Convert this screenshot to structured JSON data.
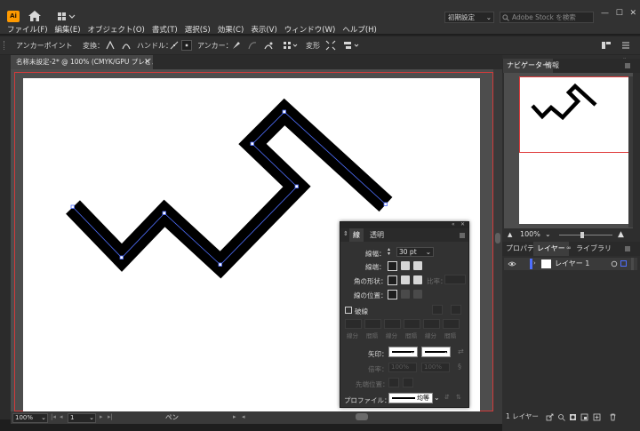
{
  "app": {
    "icon_text": "Ai"
  },
  "menu": [
    "ファイル(F)",
    "編集(E)",
    "オブジェクト(O)",
    "書式(T)",
    "選択(S)",
    "効果(C)",
    "表示(V)",
    "ウィンドウ(W)",
    "ヘルプ(H)"
  ],
  "workspace": {
    "label": "初期設定"
  },
  "search": {
    "placeholder": "Adobe Stock を検索"
  },
  "window_controls": {
    "minimize": "—",
    "maximize": "☐",
    "close": "✕"
  },
  "control_bar": {
    "anchor_point": "アンカーポイント",
    "convert": "変換：",
    "handle": "ハンドル：",
    "anchor": "アンカー：",
    "transform": "変形"
  },
  "document_tab": {
    "title": "名称未設定-2* @ 100% (CMYK/GPU プレビュー)",
    "close": "✕"
  },
  "status_bar": {
    "zoom": "100%",
    "artboard": "1",
    "tool": "ペン"
  },
  "navigator": {
    "tabs": [
      "ナビゲーター",
      "情報"
    ],
    "zoom": "100%"
  },
  "layers_panel": {
    "tabs": [
      "プロパティ",
      "レイヤー",
      "ライブラリ"
    ],
    "layer_name": "レイヤー 1",
    "count": "1 レイヤー"
  },
  "stroke_panel": {
    "tabs": [
      "線",
      "透明"
    ],
    "weight_label": "線幅：",
    "weight_value": "30 pt",
    "cap_label": "線端：",
    "corner_label": "角の形状：",
    "limit_label": "比率：",
    "align_label": "線の位置：",
    "dashed_label": "破線",
    "dash_labels": [
      "線分",
      "間隔",
      "線分",
      "間隔",
      "線分",
      "間隔"
    ],
    "arrow_label": "矢印：",
    "scale_label": "倍率：",
    "scale_values": [
      "100%",
      "100%"
    ],
    "tip_label": "先端位置：",
    "profile_label": "プロファイル：",
    "profile_value": "均等"
  },
  "colors": {
    "ui_bg": "#323232",
    "canvas": "#4d4d4d",
    "artboard": "#ffffff",
    "bleed": "#d23b3b",
    "path": "#000000",
    "anchor": "#4f6fff",
    "accent": "#ff9a00"
  }
}
